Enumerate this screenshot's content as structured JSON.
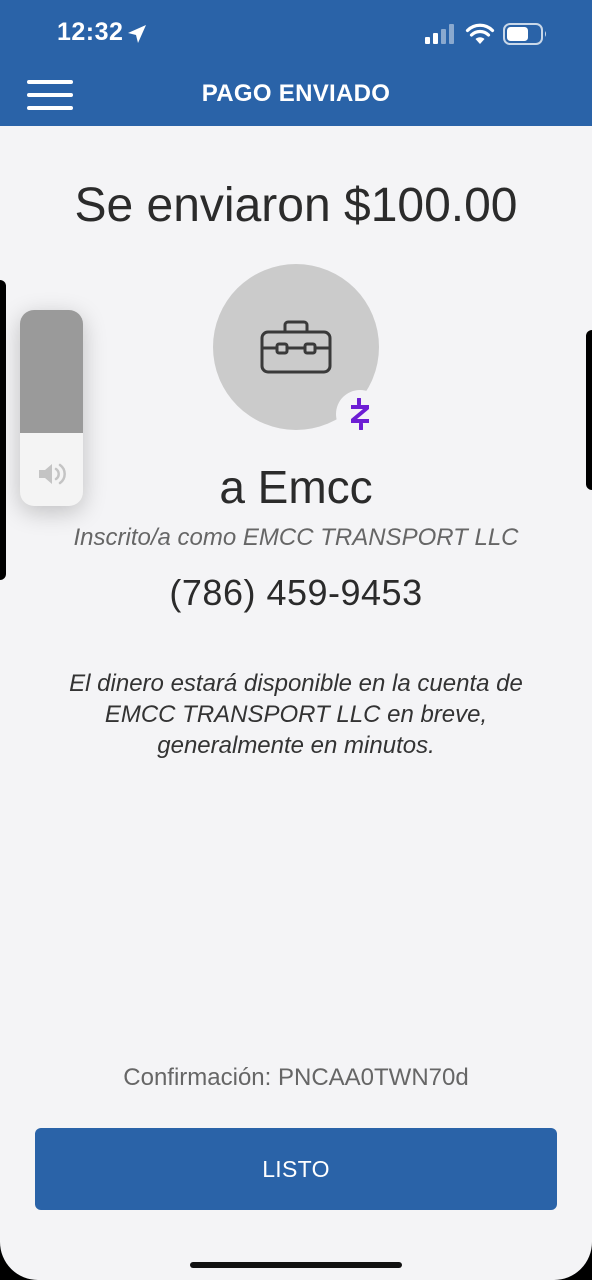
{
  "status_bar": {
    "time": "12:32",
    "icons": [
      "location-arrow-icon",
      "cellular-signal-icon",
      "wifi-icon",
      "battery-icon"
    ]
  },
  "header": {
    "menu_icon": "hamburger-menu-icon",
    "title": "PAGO ENVIADO",
    "background_color": "#2a63a8"
  },
  "payment": {
    "amount_title": "Se enviaron $100.00",
    "avatar_icon": "briefcase-icon",
    "badge_icon": "zelle-icon",
    "badge_color": "#6d1ed4",
    "recipient": "a Emcc",
    "enrolled_as": "Inscrito/a como EMCC TRANSPORT LLC",
    "phone": "(786) 459-9453",
    "notice": "El dinero estará disponible en la cuenta de EMCC TRANSPORT LLC en breve, generalmente en minutos."
  },
  "footer": {
    "confirmation": "Confirmación: PNCAA0TWN70d",
    "done_label": "LISTO",
    "button_color": "#2a63a8"
  },
  "volume_hud": {
    "icon": "speaker-icon",
    "level": 0.63
  }
}
